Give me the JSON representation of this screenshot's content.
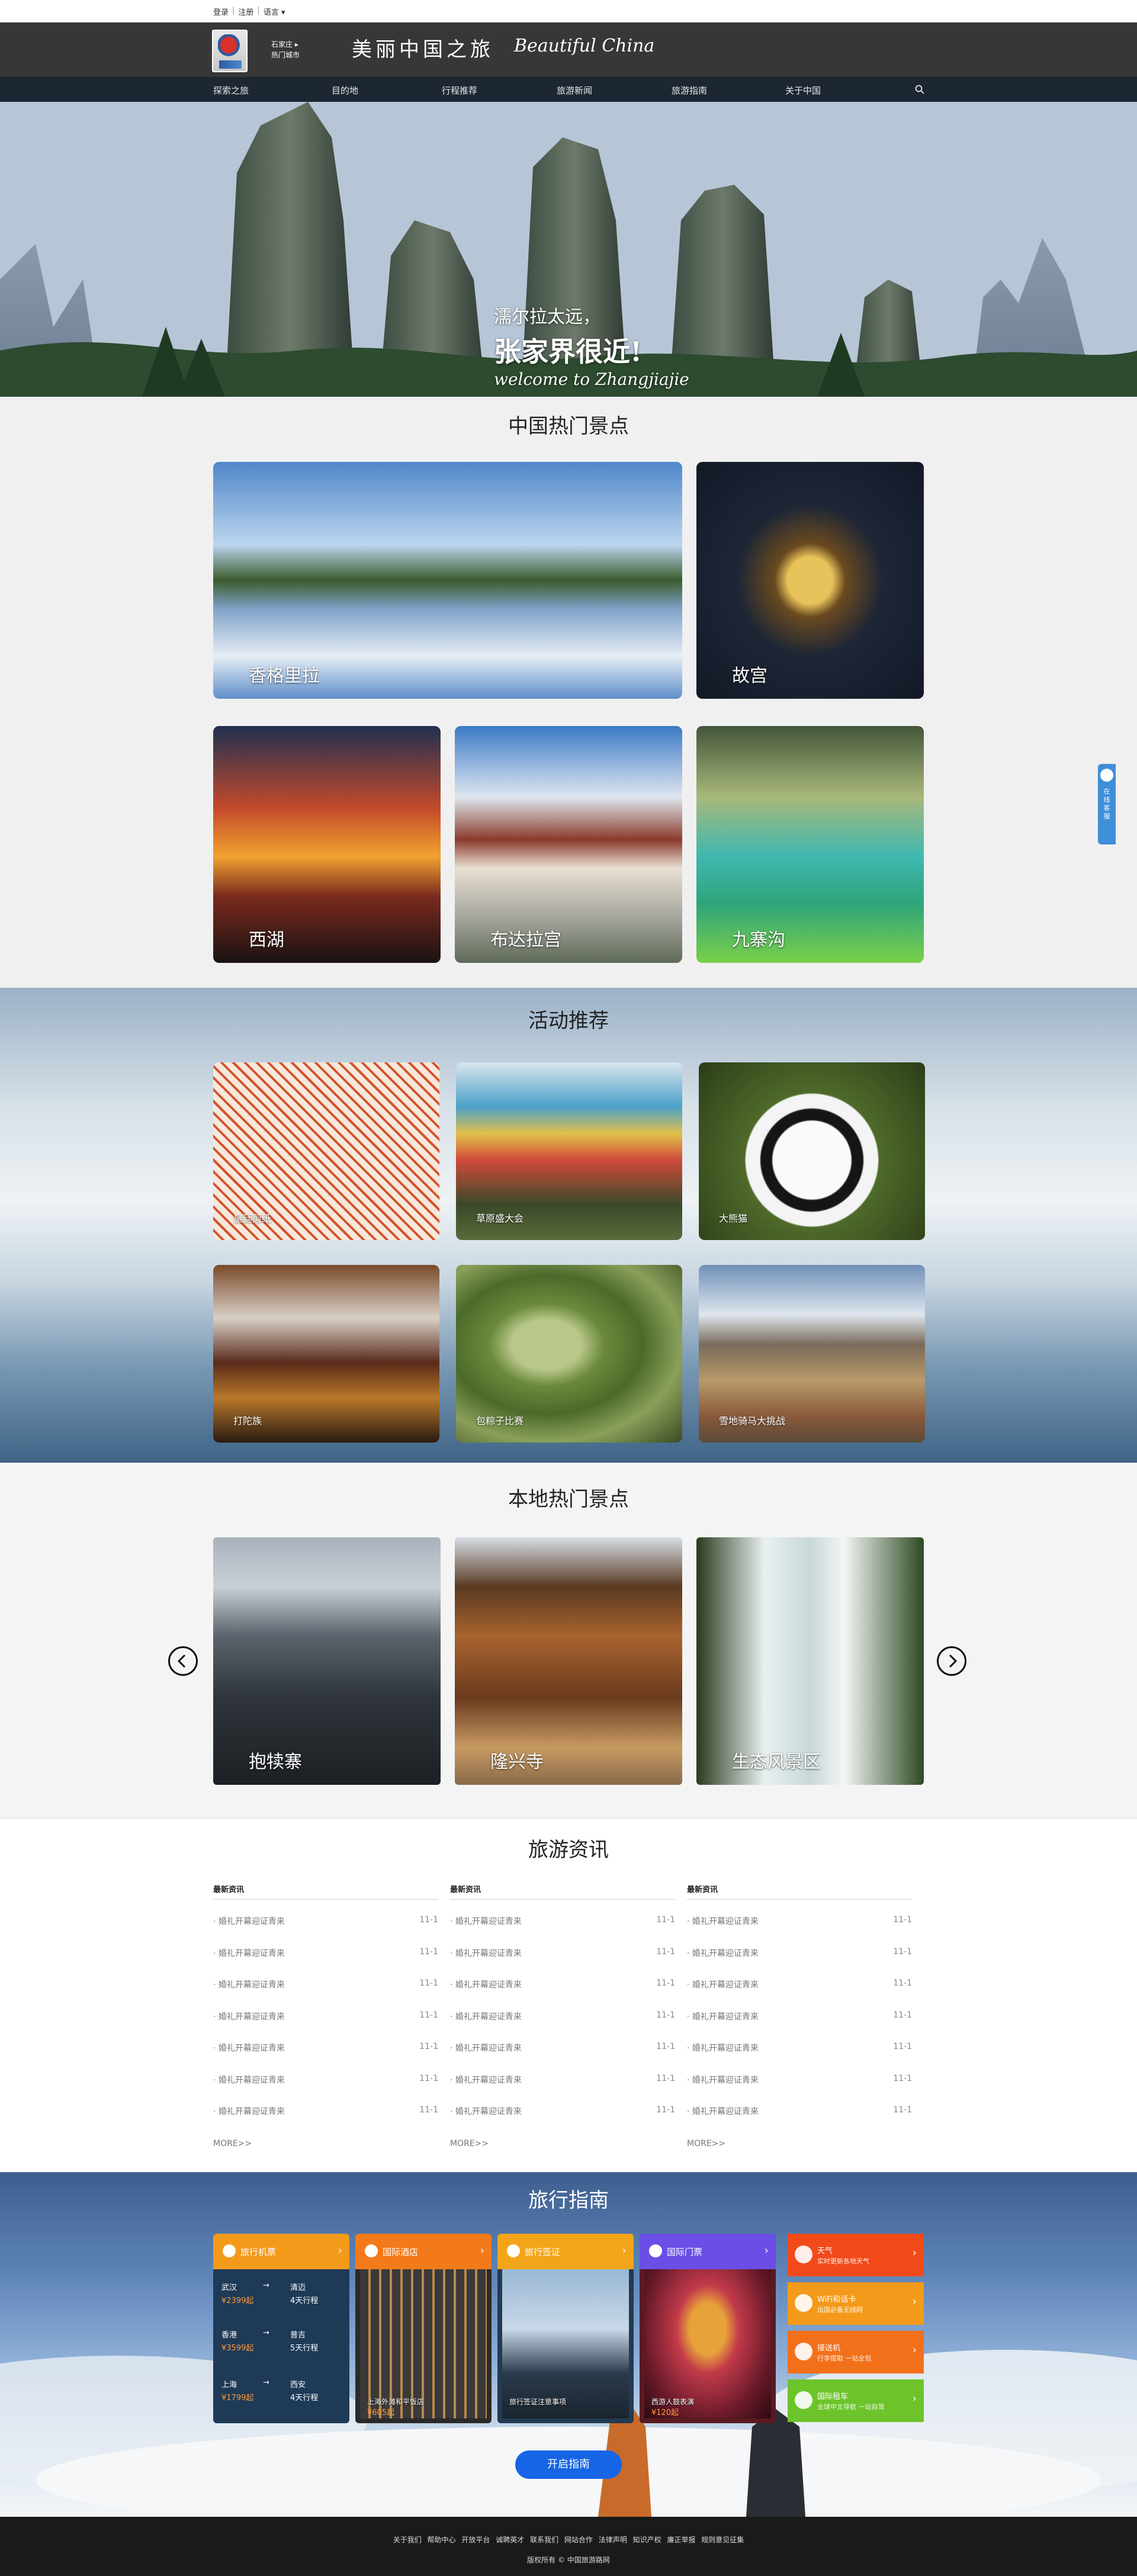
{
  "topbar": {
    "login": "登录",
    "register": "注册",
    "language": "语言 ▾",
    "sep": "|"
  },
  "header": {
    "city_line1": "石家庄 ▸",
    "city_line2": "热门城市",
    "title": "美丽中国之旅",
    "subtitle": "Beautiful China"
  },
  "nav": {
    "items": [
      "探索之旅",
      "目的地",
      "行程推荐",
      "旅游新闻",
      "旅游指南",
      "关于中国"
    ],
    "search_icon": "search-icon"
  },
  "hero": {
    "line1": "濡尔拉太远，",
    "line2": "张家界很近!",
    "line3": "welcome to Zhangjiajie",
    "slides": 3,
    "active_slide": 1
  },
  "hot_china": {
    "title": "中国热门景点",
    "spots": [
      "香格里拉",
      "故宫",
      "西湖",
      "布达拉宫",
      "九寨沟"
    ]
  },
  "activities": {
    "title": "活动推荐",
    "items": [
      "皇廷剪纸",
      "草原盛大会",
      "大熊猫",
      "打陀族",
      "包粽子比赛",
      "雪地骑马大挑战"
    ]
  },
  "local_hot": {
    "title": "本地热门景点",
    "spots": [
      "抱犊寨",
      "隆兴寺",
      "生态风景区"
    ],
    "prev_icon": "chevron-left-icon",
    "next_icon": "chevron-right-icon"
  },
  "news": {
    "title": "旅游资讯",
    "columns": [
      {
        "head": "最新资讯",
        "rows": [
          {
            "t": "· 婚礼开幕迎证青来",
            "d": "11-1"
          },
          {
            "t": "· 婚礼开幕迎证青来",
            "d": "11-1"
          },
          {
            "t": "· 婚礼开幕迎证青来",
            "d": "11-1"
          },
          {
            "t": "· 婚礼开幕迎证青来",
            "d": "11-1"
          },
          {
            "t": "· 婚礼开幕迎证青来",
            "d": "11-1"
          },
          {
            "t": "· 婚礼开幕迎证青来",
            "d": "11-1"
          },
          {
            "t": "· 婚礼开幕迎证青来",
            "d": "11-1"
          }
        ],
        "more": "MORE>>"
      },
      {
        "head": "最新资讯",
        "rows": [
          {
            "t": "· 婚礼开幕迎证青来",
            "d": "11-1"
          },
          {
            "t": "· 婚礼开幕迎证青来",
            "d": "11-1"
          },
          {
            "t": "· 婚礼开幕迎证青来",
            "d": "11-1"
          },
          {
            "t": "· 婚礼开幕迎证青来",
            "d": "11-1"
          },
          {
            "t": "· 婚礼开幕迎证青来",
            "d": "11-1"
          },
          {
            "t": "· 婚礼开幕迎证青来",
            "d": "11-1"
          },
          {
            "t": "· 婚礼开幕迎证青来",
            "d": "11-1"
          }
        ],
        "more": "MORE>>"
      },
      {
        "head": "最新资讯",
        "rows": [
          {
            "t": "· 婚礼开幕迎证青来",
            "d": "11-1"
          },
          {
            "t": "· 婚礼开幕迎证青来",
            "d": "11-1"
          },
          {
            "t": "· 婚礼开幕迎证青来",
            "d": "11-1"
          },
          {
            "t": "· 婚礼开幕迎证青来",
            "d": "11-1"
          },
          {
            "t": "· 婚礼开幕迎证青来",
            "d": "11-1"
          },
          {
            "t": "· 婚礼开幕迎证青来",
            "d": "11-1"
          },
          {
            "t": "· 婚礼开幕迎证青来",
            "d": "11-1"
          }
        ],
        "more": "MORE>>"
      }
    ]
  },
  "guide": {
    "title": "旅行指南",
    "cards": [
      {
        "head": "旅行机票",
        "color": "#f39a1a"
      },
      {
        "head": "国际酒店",
        "color": "#f37a1a",
        "caption": "上海外滩和平饭店",
        "price": "¥605起"
      },
      {
        "head": "旅行签证",
        "color": "#f3a51a",
        "caption": "旅行签证注意事项"
      },
      {
        "head": "国际门票",
        "color": "#6a4ee6",
        "caption": "西游人鼓表演",
        "price": "¥120起"
      }
    ],
    "flights": [
      {
        "from": "武汉",
        "to": "清迈",
        "price": "¥2399起",
        "dur": "4天行程"
      },
      {
        "from": "香港",
        "to": "普吉",
        "price": "¥3599起",
        "dur": "5天行程"
      },
      {
        "from": "上海",
        "to": "西安",
        "price": "¥1799起",
        "dur": "4天行程"
      }
    ],
    "flight_arrow": "→",
    "side": [
      {
        "t1": "天气",
        "t2": "实时更新各地天气",
        "color": "#f34a1a"
      },
      {
        "t1": "WiFi和话卡",
        "t2": "出国必备无线网",
        "color": "#f39a1a"
      },
      {
        "t1": "接送机",
        "t2": "行李提取 一站全包",
        "color": "#f3701a"
      },
      {
        "t1": "国际租车",
        "t2": "全球中文导航 一站自驾",
        "color": "#6cc42a"
      }
    ],
    "button": "开启指南"
  },
  "footer": {
    "links": [
      "关于我们",
      "帮助中心",
      "开放平台",
      "诚聘英才",
      "联系我们",
      "网站合作",
      "法律声明",
      "知识产权",
      "廉正举报",
      "规则意见征集"
    ],
    "copyright": "版权所有 © 中国旅游路网"
  },
  "float_tab": {
    "text": "在线客服"
  }
}
